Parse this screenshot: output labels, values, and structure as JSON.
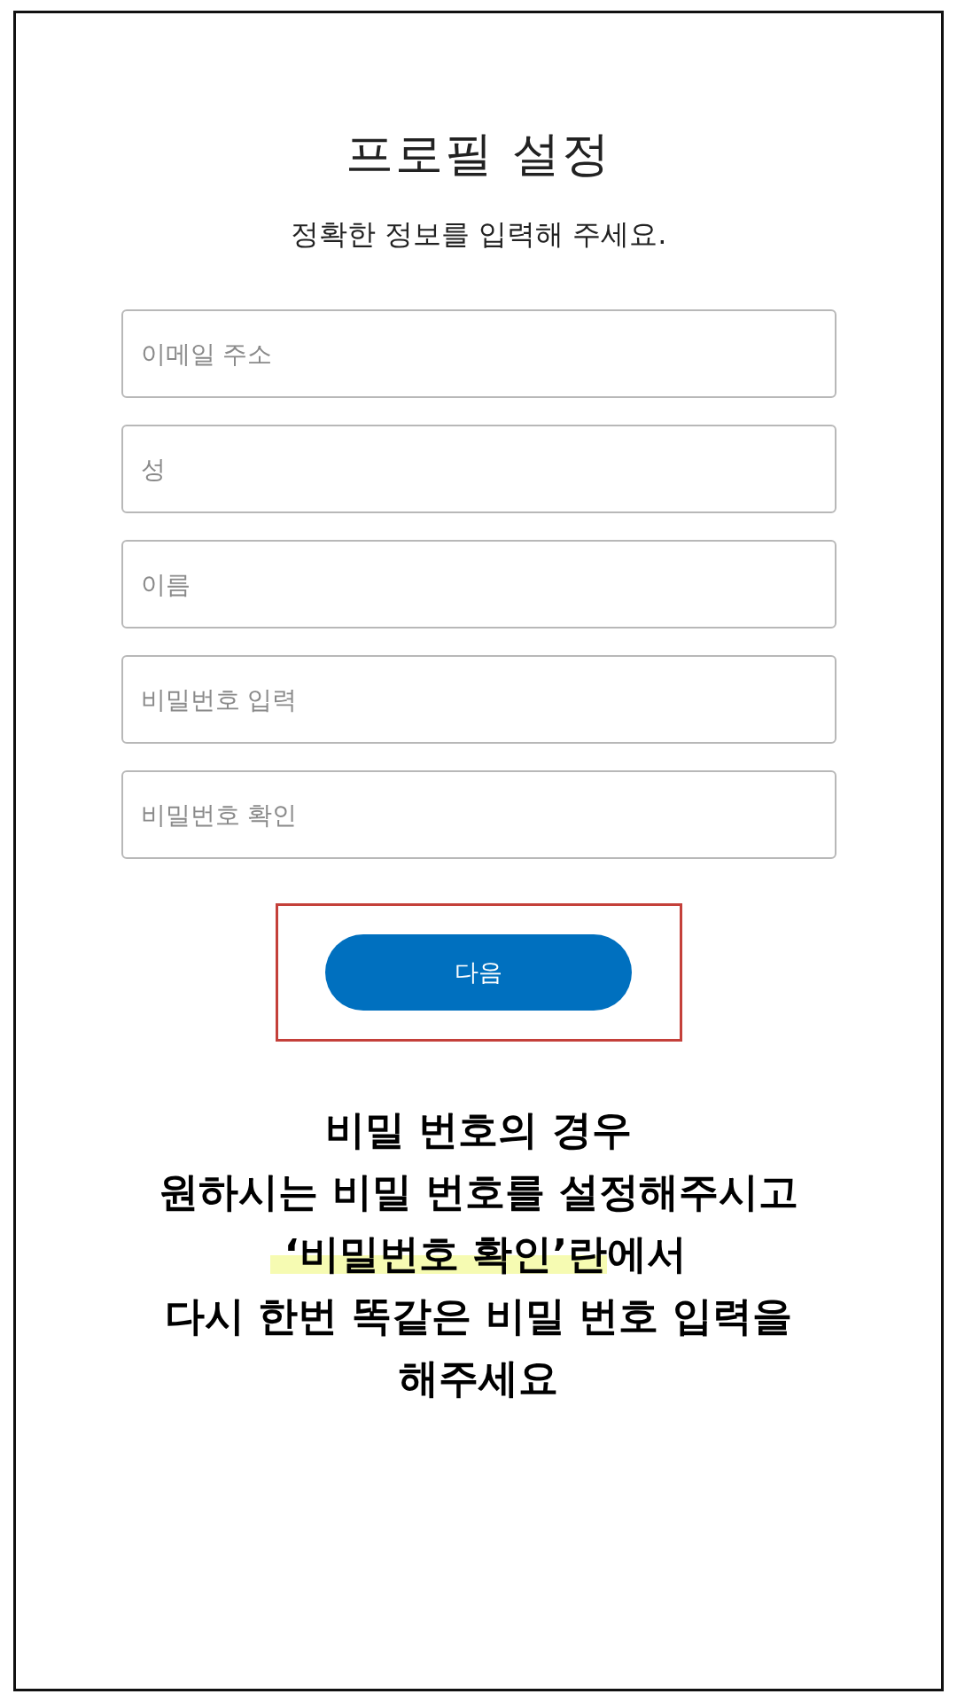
{
  "header": {
    "title": "프로필 설정",
    "subtitle": "정확한 정보를 입력해 주세요."
  },
  "fields": [
    {
      "placeholder": "이메일 주소"
    },
    {
      "placeholder": "성"
    },
    {
      "placeholder": "이름"
    },
    {
      "placeholder": "비밀번호 입력"
    },
    {
      "placeholder": "비밀번호 확인"
    }
  ],
  "next_button": {
    "label": "다음",
    "annotated": true
  },
  "instructions": {
    "lines": [
      [
        {
          "text": "비밀 번호의 경우",
          "highlighted": false
        }
      ],
      [
        {
          "text": "원하시는 비밀 번호를 설정해주시고",
          "highlighted": false
        }
      ],
      [
        {
          "text": "‘비밀번호 확인’란",
          "highlighted": true
        },
        {
          "text": "에서",
          "highlighted": false
        }
      ],
      [
        {
          "text": "다시 한번 똑같은 비밀 번호 입력을",
          "highlighted": false
        }
      ],
      [
        {
          "text": "해주세요",
          "highlighted": false
        }
      ]
    ]
  }
}
